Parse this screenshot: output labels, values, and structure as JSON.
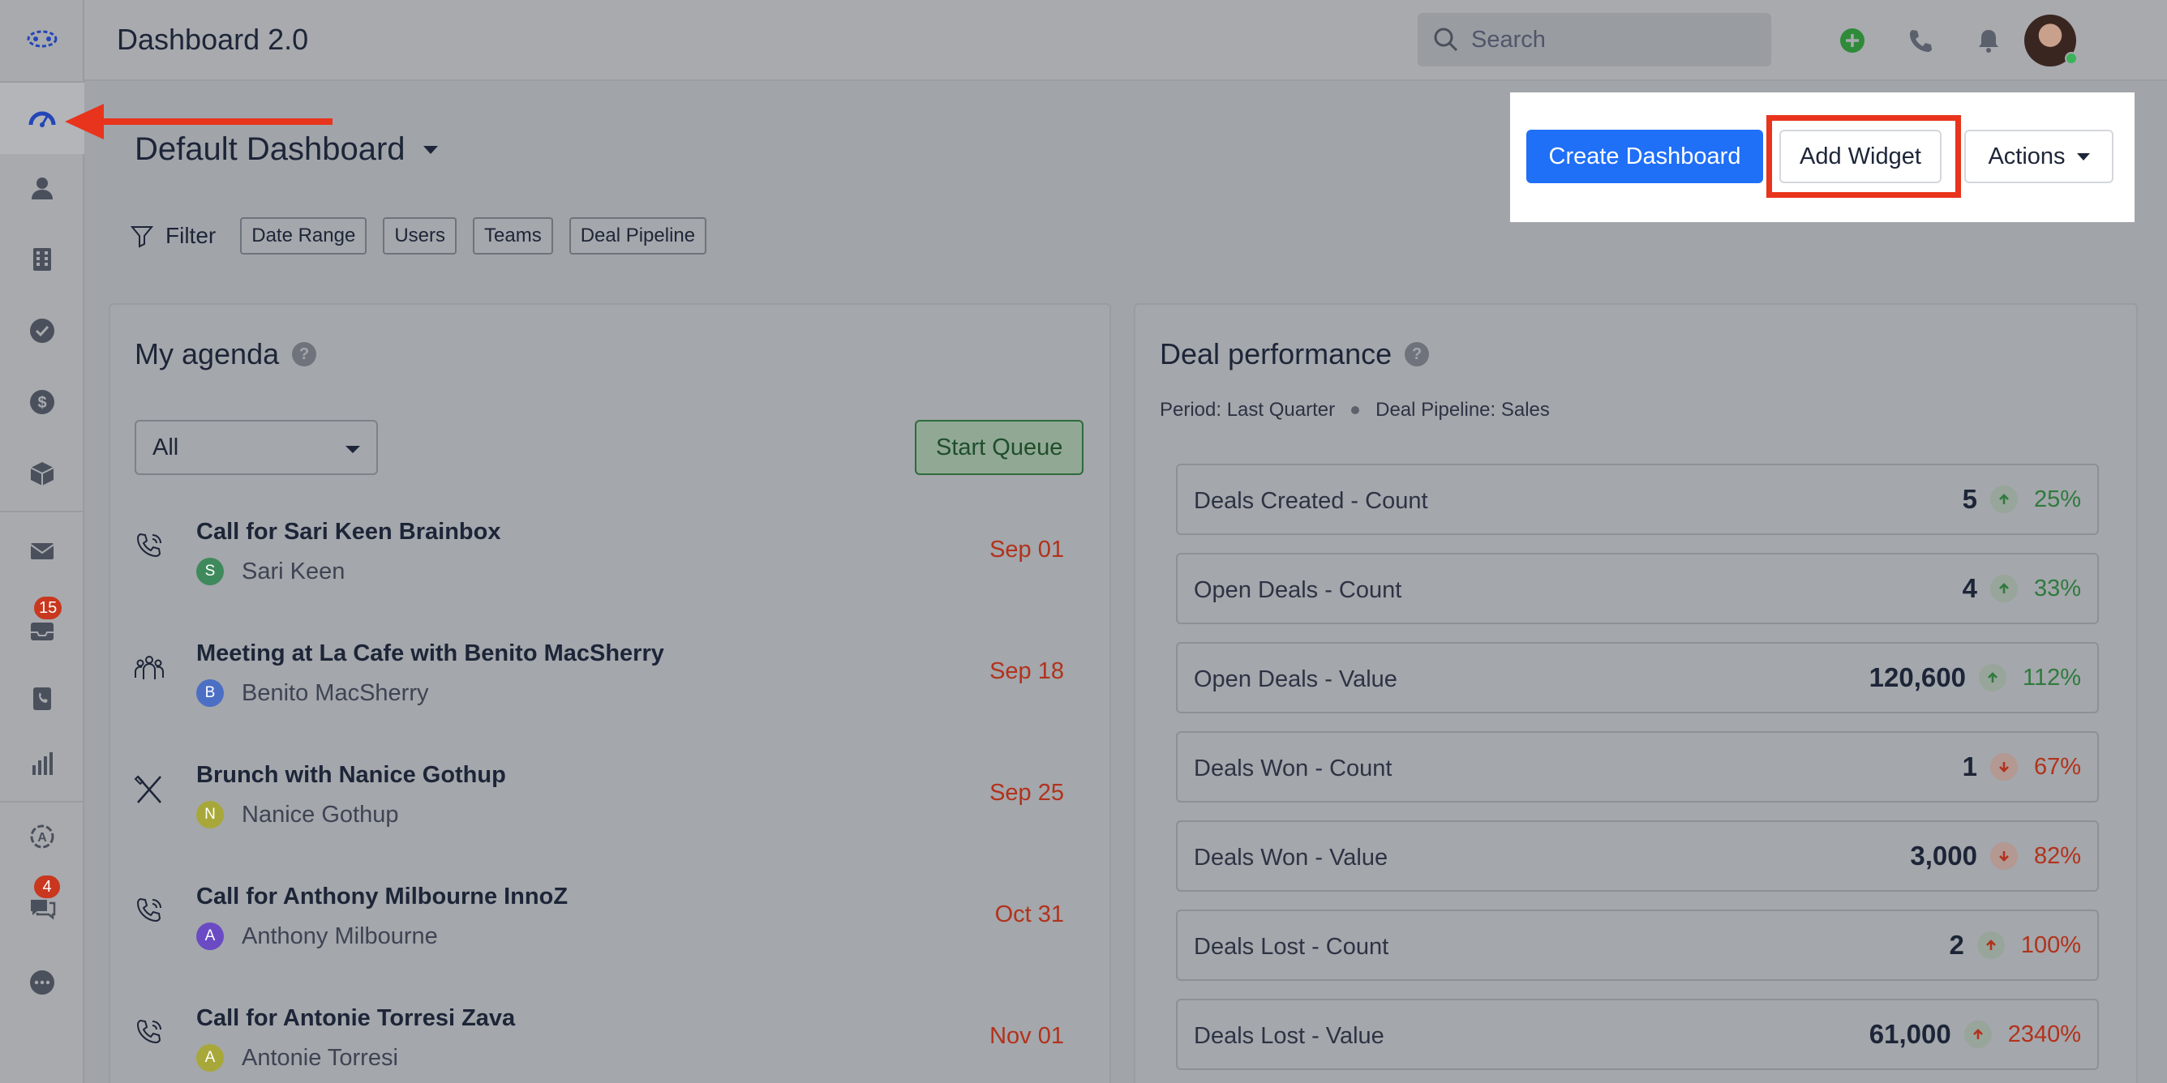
{
  "app": {
    "title": "Dashboard 2.0"
  },
  "search": {
    "placeholder": "Search"
  },
  "sidebar": {
    "items": [
      {
        "name": "logo",
        "icon": "logo-icon"
      },
      {
        "name": "dashboard",
        "icon": "speedometer-icon",
        "active": true
      },
      {
        "name": "contacts",
        "icon": "person-icon"
      },
      {
        "name": "companies",
        "icon": "building-icon"
      },
      {
        "name": "tasks",
        "icon": "check-circle-icon"
      },
      {
        "name": "deals",
        "icon": "dollar-icon"
      },
      {
        "name": "products",
        "icon": "box-icon"
      },
      {
        "name": "email",
        "icon": "envelope-icon"
      },
      {
        "name": "inbox",
        "icon": "inbox-icon",
        "badge": "15"
      },
      {
        "name": "phone-book",
        "icon": "phone-book-icon"
      },
      {
        "name": "reports",
        "icon": "bar-chart-icon"
      },
      {
        "name": "automation",
        "icon": "automation-icon"
      },
      {
        "name": "chat",
        "icon": "chat-icon",
        "badge": "4"
      },
      {
        "name": "more",
        "icon": "more-icon"
      }
    ]
  },
  "dashboard": {
    "title": "Default Dashboard",
    "filter_label": "Filter",
    "chips": [
      "Date Range",
      "Users",
      "Teams",
      "Deal Pipeline"
    ],
    "create_label": "Create Dashboard",
    "add_widget_label": "Add Widget",
    "actions_label": "Actions"
  },
  "agenda": {
    "title": "My agenda",
    "help": "?",
    "select_value": "All",
    "start_queue_label": "Start Queue",
    "items": [
      {
        "type": "call",
        "title": "Call for Sari Keen Brainbox",
        "contact": "Sari Keen",
        "initial": "S",
        "initial_color": "#3f8a5c",
        "date": "Sep 01"
      },
      {
        "type": "meeting",
        "title": "Meeting at La Cafe with Benito MacSherry",
        "contact": "Benito MacSherry",
        "initial": "B",
        "initial_color": "#4b6fc4",
        "date": "Sep 18"
      },
      {
        "type": "meal",
        "title": "Brunch with Nanice Gothup",
        "contact": "Nanice Gothup",
        "initial": "N",
        "initial_color": "#a8a83a",
        "date": "Sep 25"
      },
      {
        "type": "call",
        "title": "Call for Anthony Milbourne InnoZ",
        "contact": "Anthony Milbourne",
        "initial": "A",
        "initial_color": "#6a4bc4",
        "date": "Oct 31"
      },
      {
        "type": "call",
        "title": "Call for Antonie Torresi Zava",
        "contact": "Antonie Torresi",
        "initial": "A",
        "initial_color": "#a8a83a",
        "date": "Nov 01"
      }
    ]
  },
  "deals": {
    "title": "Deal performance",
    "help": "?",
    "period": "Period: Last Quarter",
    "pipeline": "Deal Pipeline: Sales",
    "metrics": [
      {
        "label": "Deals Created - Count",
        "value": "5",
        "trend": "up",
        "pct": "25%",
        "tone": "up"
      },
      {
        "label": "Open Deals - Count",
        "value": "4",
        "trend": "up",
        "pct": "33%",
        "tone": "up"
      },
      {
        "label": "Open Deals - Value",
        "value": "120,600",
        "trend": "up",
        "pct": "112%",
        "tone": "up"
      },
      {
        "label": "Deals Won - Count",
        "value": "1",
        "trend": "down",
        "pct": "67%",
        "tone": "down"
      },
      {
        "label": "Deals Won - Value",
        "value": "3,000",
        "trend": "down",
        "pct": "82%",
        "tone": "down"
      },
      {
        "label": "Deals Lost - Count",
        "value": "2",
        "trend": "up",
        "pct": "100%",
        "tone": "down"
      },
      {
        "label": "Deals Lost - Value",
        "value": "61,000",
        "trend": "up",
        "pct": "2340%",
        "tone": "down"
      }
    ]
  },
  "colors": {
    "accent": "#1f6ff7",
    "highlight": "#e8341c",
    "positive": "#2f7a3e",
    "negative": "#b2321c"
  }
}
